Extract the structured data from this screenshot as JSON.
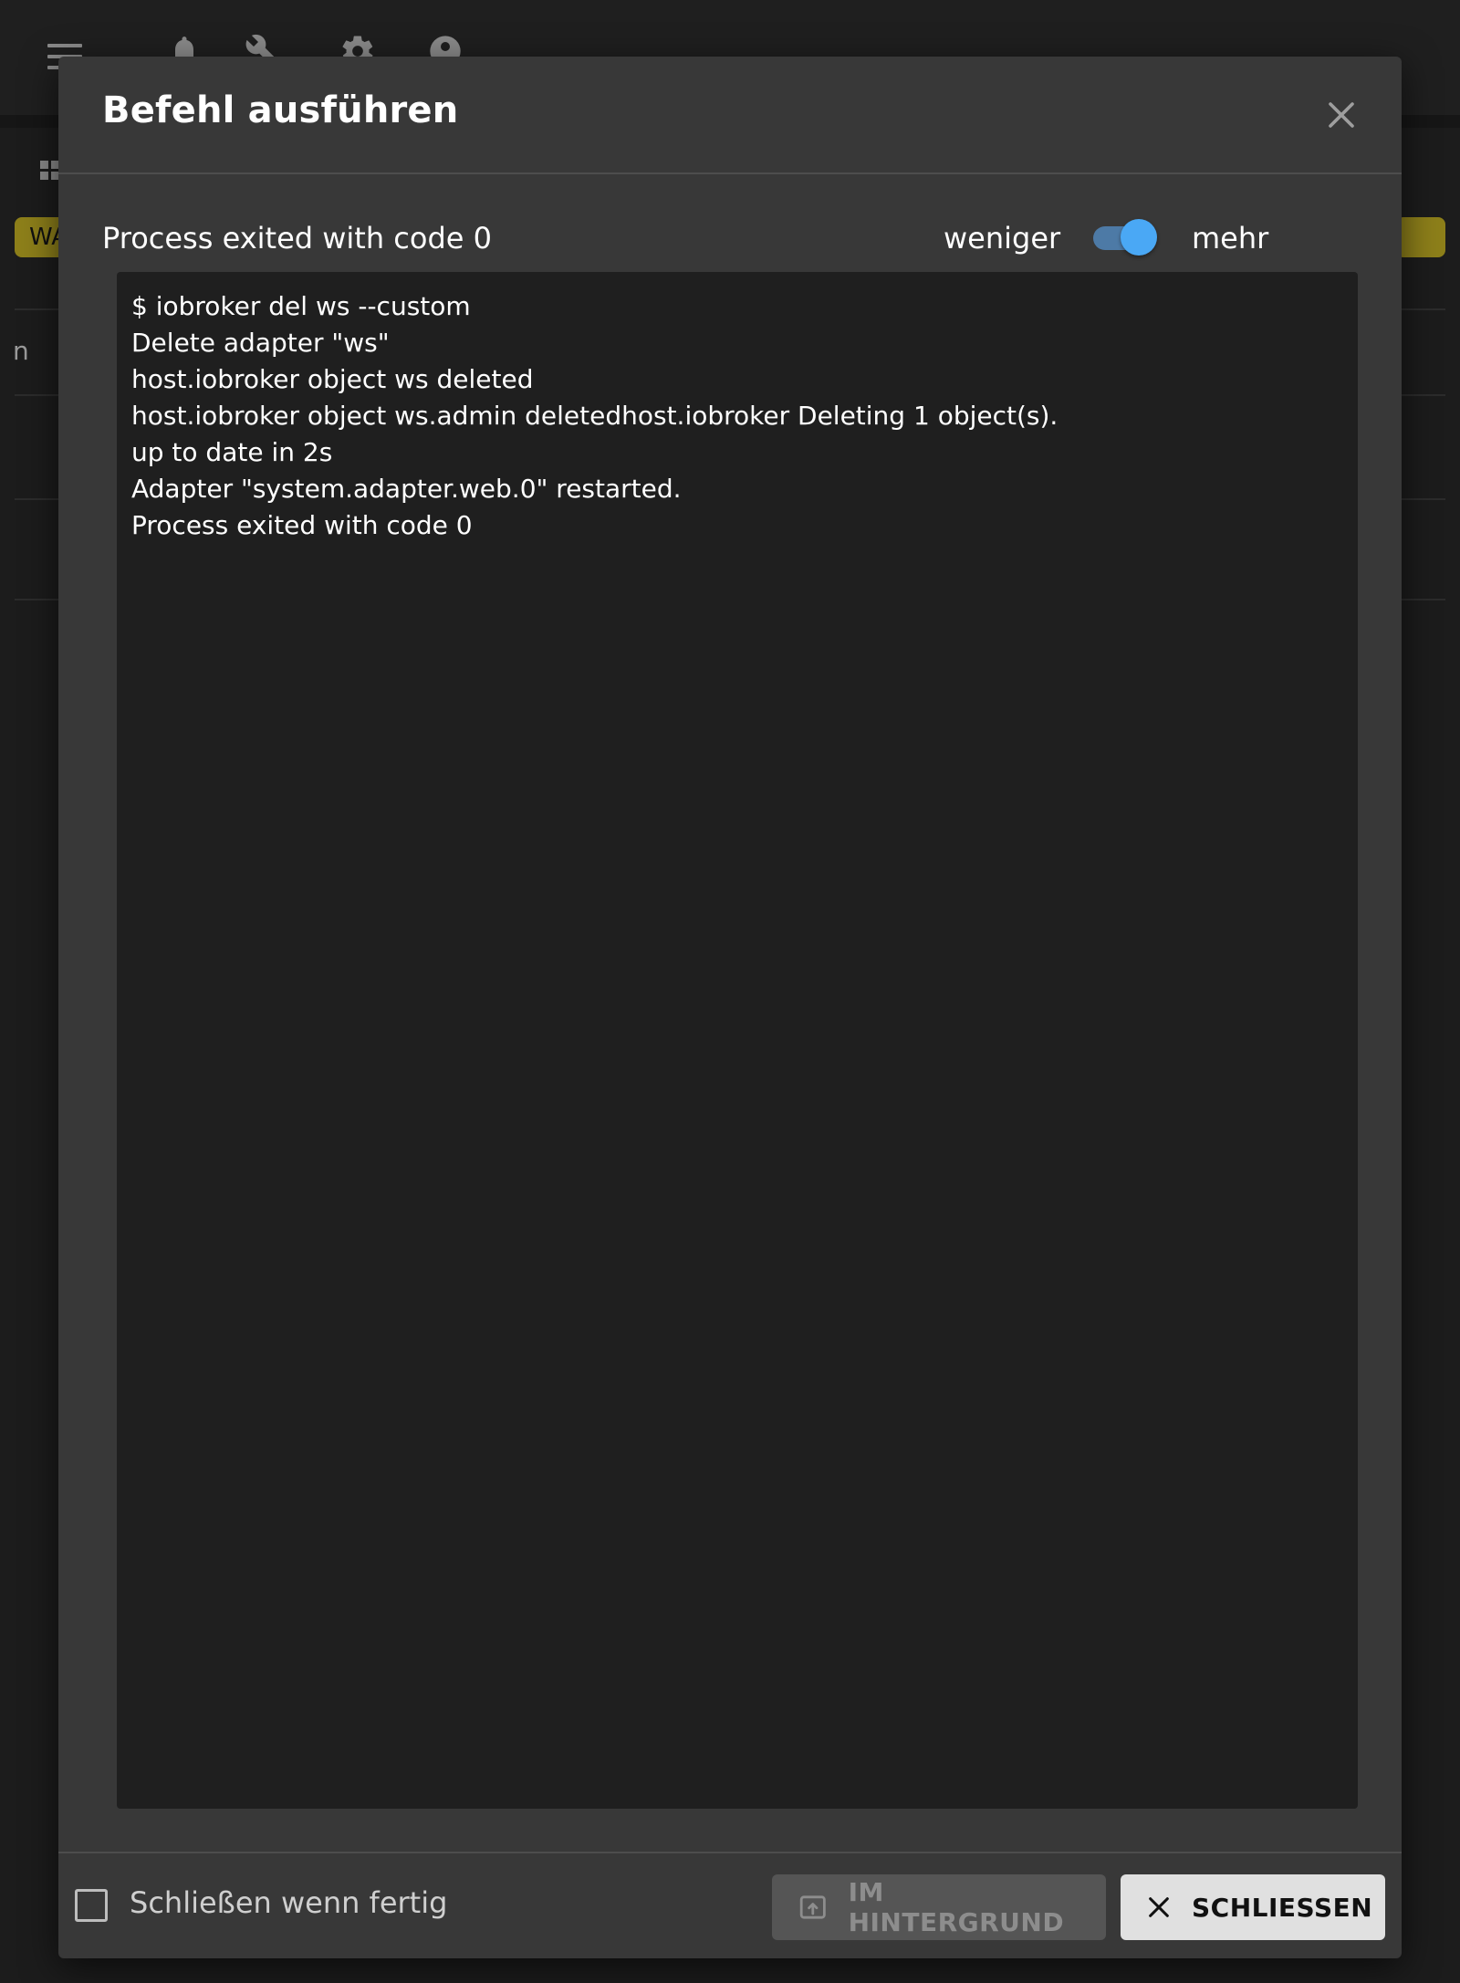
{
  "background": {
    "badge_text": "WA",
    "side_letter": "n"
  },
  "dialog": {
    "title": "Befehl ausführen",
    "status": "Process exited with code 0",
    "toggle": {
      "less_label": "weniger",
      "more_label": "mehr",
      "state": "mehr"
    },
    "output_lines": [
      "$ iobroker del ws --custom",
      "Delete adapter \"ws\"",
      "host.iobroker object ws deleted",
      "host.iobroker object ws.admin deletedhost.iobroker Deleting 1 object(s).",
      "up to date in 2s",
      "Adapter \"system.adapter.web.0\" restarted.",
      "Process exited with code 0"
    ],
    "footer": {
      "auto_close_label": "Schließen wenn fertig",
      "auto_close_checked": false,
      "background_button_label": "IM HINTERGRUND",
      "close_button_label": "SCHLIESSEN"
    }
  },
  "colors": {
    "accent": "#4aa8f5",
    "dialog_bg": "#383838",
    "output_bg": "#1f1f1f",
    "badge": "#8d7f1a"
  },
  "icons": [
    "menu-icon",
    "bell-icon",
    "wrench-icon",
    "gear-icon",
    "help-icon",
    "grid-icon",
    "close-icon",
    "upload-icon",
    "x-icon"
  ]
}
